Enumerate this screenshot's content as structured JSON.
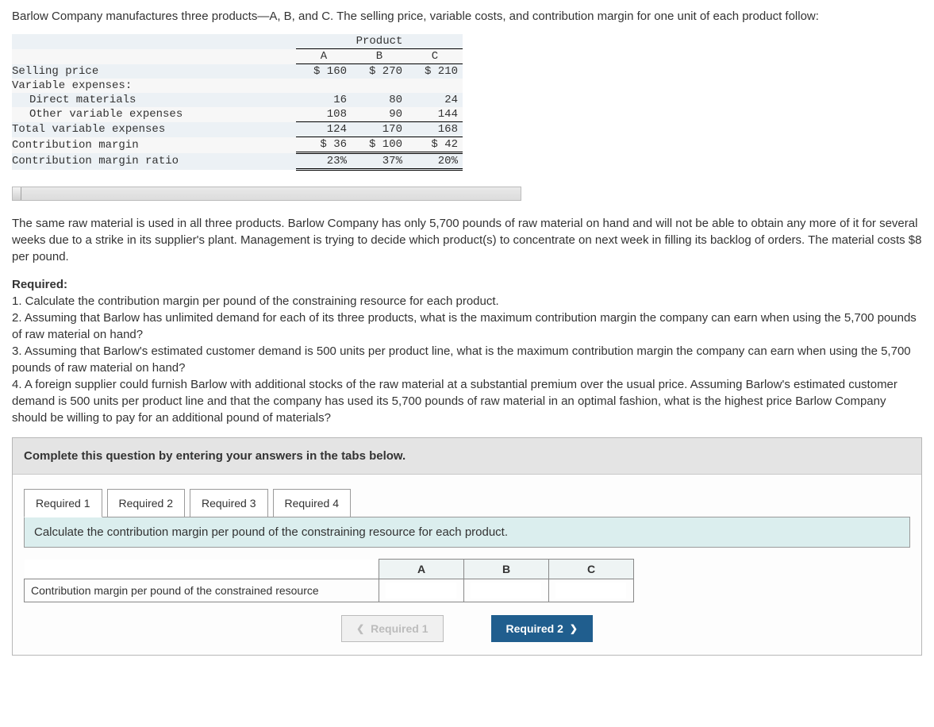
{
  "intro": "Barlow Company manufactures three products—A, B, and C. The selling price, variable costs, and contribution margin for one unit of each product follow:",
  "table": {
    "header_group": "Product",
    "cols": [
      "A",
      "B",
      "C"
    ],
    "rows": {
      "selling_price": {
        "label": "Selling price",
        "a": "$ 160",
        "b": "$ 270",
        "c": "$ 210"
      },
      "var_exp_label": {
        "label": "Variable expenses:"
      },
      "direct_materials": {
        "label": "Direct materials",
        "a": "16",
        "b": "80",
        "c": "24"
      },
      "other_var": {
        "label": "Other variable expenses",
        "a": "108",
        "b": "90",
        "c": "144"
      },
      "total_var": {
        "label": "Total variable expenses",
        "a": "124",
        "b": "170",
        "c": "168"
      },
      "cm": {
        "label": "Contribution margin",
        "a": "$  36",
        "b": "$ 100",
        "c": "$  42"
      },
      "cm_ratio": {
        "label": "Contribution margin ratio",
        "a": "23%",
        "b": "37%",
        "c": "20%"
      }
    }
  },
  "paragraph": "The same raw material is used in all three products. Barlow Company has only 5,700 pounds of raw material on hand and will not be able to obtain any more of it for several weeks due to a strike in its supplier's plant. Management is trying to decide which product(s) to concentrate on next week in filling its backlog of orders. The material costs $8 per pound.",
  "required_label": "Required:",
  "requirements": [
    "1. Calculate the contribution margin per pound of the constraining resource for each product.",
    "2. Assuming that Barlow has unlimited demand for each of its three products, what is the maximum contribution margin the company can earn when using the 5,700 pounds of raw material on hand?",
    "3. Assuming that Barlow's estimated customer demand is 500 units per product line, what is the maximum contribution margin the company can earn when using the 5,700 pounds of raw material on hand?",
    "4. A foreign supplier could furnish Barlow with additional stocks of the raw material at a substantial premium over the usual price. Assuming Barlow's estimated customer demand is 500 units per product line and that the company has used its 5,700 pounds of raw material in an optimal fashion, what is the highest price Barlow Company should be willing to pay for an additional pound of materials?"
  ],
  "answer_area": {
    "instruction": "Complete this question by entering your answers in the tabs below.",
    "tabs": [
      "Required 1",
      "Required 2",
      "Required 3",
      "Required 4"
    ],
    "active_tab": 0,
    "prompt": "Calculate the contribution margin per pound of the constraining resource for each product.",
    "ans_cols": [
      "A",
      "B",
      "C"
    ],
    "ans_row_label": "Contribution margin per pound of the constrained resource",
    "nav_prev": "Required 1",
    "nav_next": "Required 2"
  },
  "chart_data": {
    "type": "table",
    "title": "Per-unit product data",
    "columns": [
      "A",
      "B",
      "C"
    ],
    "rows": [
      {
        "label": "Selling price",
        "values": [
          160,
          270,
          210
        ]
      },
      {
        "label": "Direct materials",
        "values": [
          16,
          80,
          24
        ]
      },
      {
        "label": "Other variable expenses",
        "values": [
          108,
          90,
          144
        ]
      },
      {
        "label": "Total variable expenses",
        "values": [
          124,
          170,
          168
        ]
      },
      {
        "label": "Contribution margin",
        "values": [
          36,
          100,
          42
        ]
      },
      {
        "label": "Contribution margin ratio (%)",
        "values": [
          23,
          37,
          20
        ]
      }
    ]
  }
}
